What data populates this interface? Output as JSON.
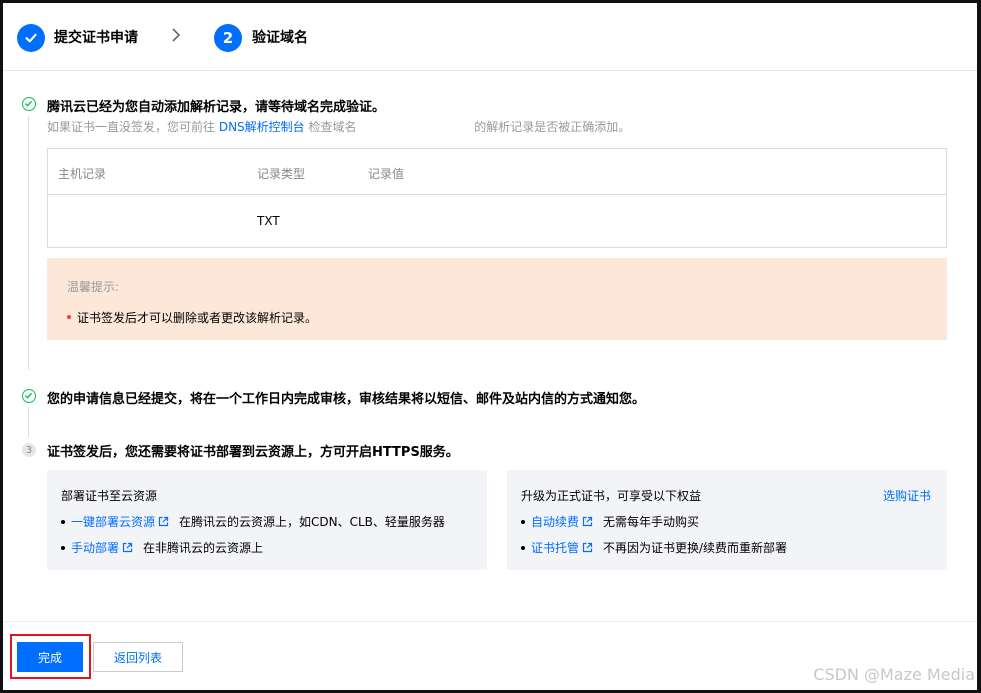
{
  "steps": [
    {
      "label": "提交证书申请",
      "state": "done"
    },
    {
      "number": "2",
      "label": "验证域名",
      "state": "active"
    }
  ],
  "section1": {
    "title": "腾讯云已经为您自动添加解析记录，请等待域名完成验证。",
    "sub_prefix": "如果证书一直没签发，您可前往",
    "sub_link": "DNS解析控制台",
    "sub_middle": "检查域名",
    "sub_suffix": "的解析记录是否被正确添加。"
  },
  "record_table": {
    "columns": [
      "主机记录",
      "记录类型",
      "记录值"
    ],
    "rows": [
      {
        "host": "",
        "type": "TXT",
        "value": ""
      }
    ]
  },
  "tip": {
    "title": "温馨提示:",
    "item": "证书签发后才可以删除或者更改该解析记录。"
  },
  "section2": {
    "title": "您的申请信息已经提交，将在一个工作日内完成审核，审核结果将以短信、邮件及站内信的方式通知您。"
  },
  "section3": {
    "number": "3",
    "title": "证书签发后，您还需要将证书部署到云资源上，方可开启HTTPS服务。"
  },
  "deploy_card": {
    "title": "部署证书至云资源",
    "items": [
      {
        "link": "一键部署云资源",
        "desc": "在腾讯云的云资源上，如CDN、CLB、轻量服务器"
      },
      {
        "link": "手动部署",
        "desc": "在非腾讯云的云资源上"
      }
    ]
  },
  "upgrade_card": {
    "title": "升级为正式证书，可享受以下权益",
    "action": "选购证书",
    "items": [
      {
        "link": "自动续费",
        "desc": "无需每年手动购买"
      },
      {
        "link": "证书托管",
        "desc": "不再因为证书更换/续费而重新部署"
      }
    ]
  },
  "footer": {
    "done_label": "完成",
    "back_label": "返回列表"
  },
  "watermark": "CSDN @Maze Media",
  "colors": {
    "primary": "#006eff",
    "success": "#0abf5b",
    "tip_bg": "#fde7d8",
    "card_bg": "#f3f4f7",
    "highlight": "#e0161e"
  }
}
